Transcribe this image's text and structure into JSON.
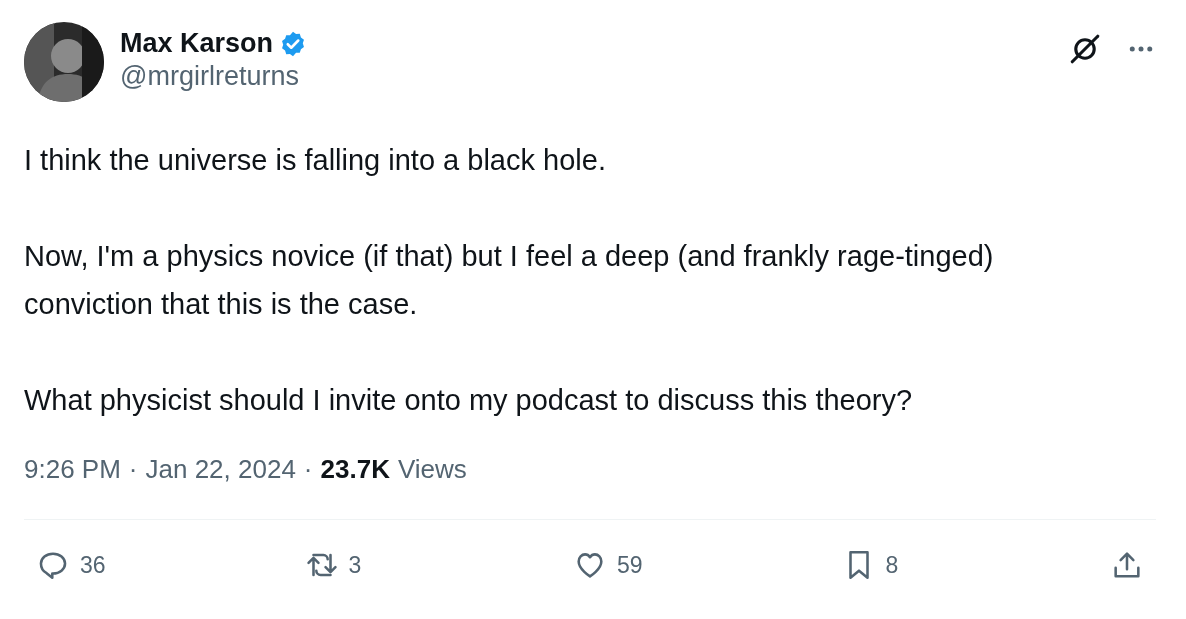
{
  "author": {
    "name": "Max Karson",
    "handle": "@mrgirlreturns",
    "verified": true
  },
  "body": [
    "I think the universe is falling into a black hole.",
    "Now, I'm a physics novice (if that) but I feel a deep (and frankly rage-tinged) conviction that this is the case.",
    "What physicist should I invite onto my podcast to discuss this theory?"
  ],
  "meta": {
    "time": "9:26 PM",
    "separator": "·",
    "date": "Jan 22, 2024",
    "separator_2": "·",
    "views_count": "23.7K",
    "views_label": "Views"
  },
  "actions": [
    {
      "kind": "reply",
      "count": "36"
    },
    {
      "kind": "repost",
      "count": "3"
    },
    {
      "kind": "like",
      "count": "59"
    },
    {
      "kind": "bookmark",
      "count": "8"
    },
    {
      "kind": "share"
    }
  ]
}
